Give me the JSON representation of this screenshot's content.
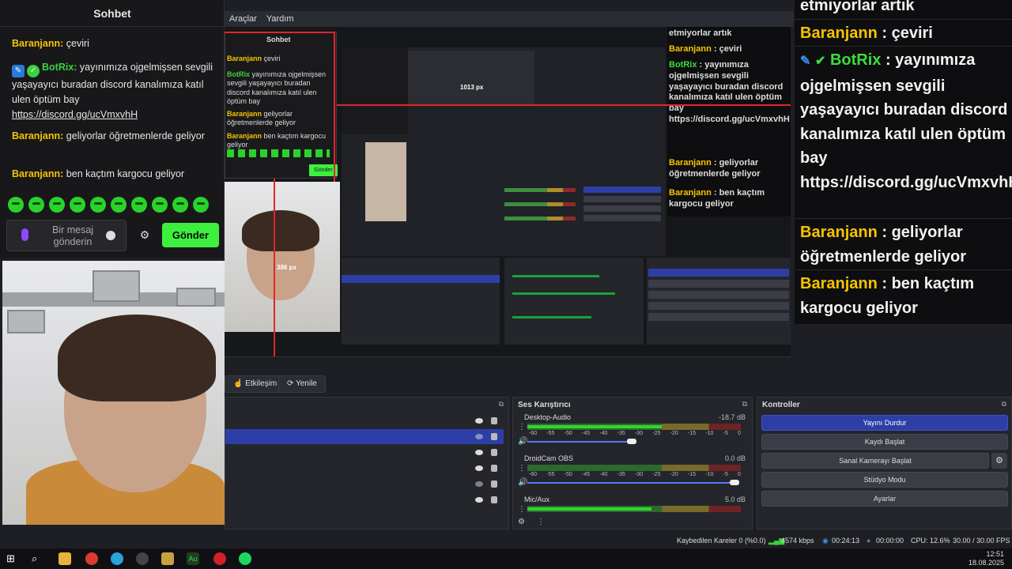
{
  "obs": {
    "menu": [
      "Araçlar",
      "Yardım"
    ],
    "nested_size_label_1": "1013 px",
    "nested_size_label_2": "386 px",
    "buttons": {
      "interact": "Etkileşim",
      "refresh": "Yenile"
    },
    "sources_title": "",
    "mixer": {
      "title": "Ses Karıştırıcı",
      "channels": [
        {
          "name": "Desktop-Audio",
          "db": "-18.7 dB",
          "level_fraction": 0.63,
          "volume_fraction": 0.49
        },
        {
          "name": "DroidCam OBS",
          "db": "0.0 dB",
          "level_fraction": 0.0,
          "volume_fraction": 0.97
        },
        {
          "name": "Mic/Aux",
          "db": "5.0 dB",
          "level_fraction": 0.58,
          "volume_fraction": 0.0
        }
      ],
      "scale": [
        "-60",
        "-55",
        "-50",
        "-45",
        "-40",
        "-35",
        "-30",
        "-25",
        "-20",
        "-15",
        "-10",
        "-5",
        "0"
      ]
    },
    "controls": {
      "title": "Kontroller",
      "buttons": [
        "Yayını Durdur",
        "Kaydı Başlat",
        "Sanal Kamerayı Başlat",
        "Stüdyo Modu",
        "Ayarlar"
      ]
    },
    "status": {
      "dropped": "Kaybedilen Kareler 0 (%0.0)",
      "bitrate": "4574 kbps",
      "stream_time": "00:24:13",
      "rec_time": "00:00:00",
      "cpu": "CPU: 12.6%",
      "fps": "30.00 / 30.00 FPS"
    }
  },
  "chat": {
    "title": "Sohbet",
    "messages": [
      {
        "user": "Baranjann",
        "text": " çeviri"
      },
      {
        "user": "BotRix",
        "text": " yayınımıza ojgelmişsen sevgili yaşayayıcı buradan discord kanalımıza katıl ulen öptüm bay",
        "link": "https://discord.gg/ucVmxvhH"
      },
      {
        "user": "Baranjann",
        "text": " geliyorlar öğretmenlerde geliyor"
      },
      {
        "user": "Baranjann",
        "text": " ben kaçtım kargocu geliyor"
      }
    ],
    "input_placeholder": "Bir mesaj gönderin",
    "send_label": "Gönder"
  },
  "right_chat": {
    "top_text": "etmiyorlar artık",
    "messages": [
      {
        "user": "Baranjann",
        "text": " : çeviri"
      },
      {
        "user": "BotRix",
        "text": " : yayınımıza ojgelmişsen sevgili yaşayayıcı buradan discord kanalımıza katıl ulen öptüm bay https://discord.gg/ucVmxvhH"
      },
      {
        "user": "Baranjann",
        "text": " : geliyorlar öğretmenlerde geliyor"
      },
      {
        "user": "Baranjann",
        "text": " : ben kaçtım kargocu geliyor"
      }
    ]
  },
  "taskbar": {
    "time": "12:51",
    "date": "18.08.2025"
  },
  "colors": {
    "accent_green": "#3ef03e",
    "username": "#f5c400",
    "obs_blue": "#2d3fa6"
  }
}
